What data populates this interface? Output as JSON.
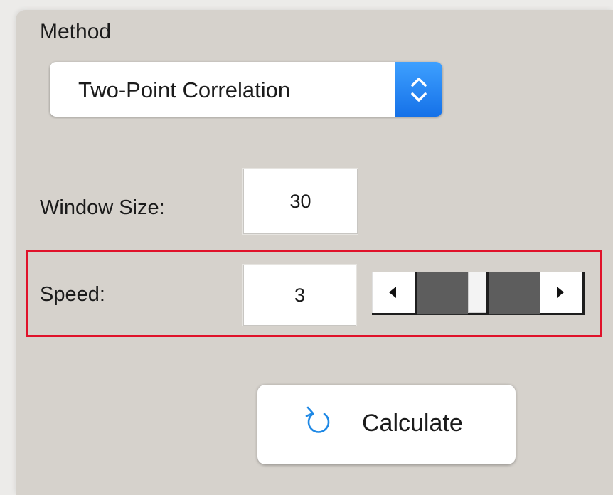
{
  "method": {
    "label": "Method",
    "selected": "Two-Point Correlation"
  },
  "window_size": {
    "label": "Window Size:",
    "value": "30"
  },
  "speed": {
    "label": "Speed:",
    "value": "3",
    "slider_level": 0.5
  },
  "calculate": {
    "label": "Calculate",
    "icon": "refresh-icon"
  },
  "colors": {
    "panel_background": "#d6d2cc",
    "select_accent": "#1d7cf2",
    "highlight_border": "#e0122a",
    "refresh_icon": "#1e88e5"
  }
}
